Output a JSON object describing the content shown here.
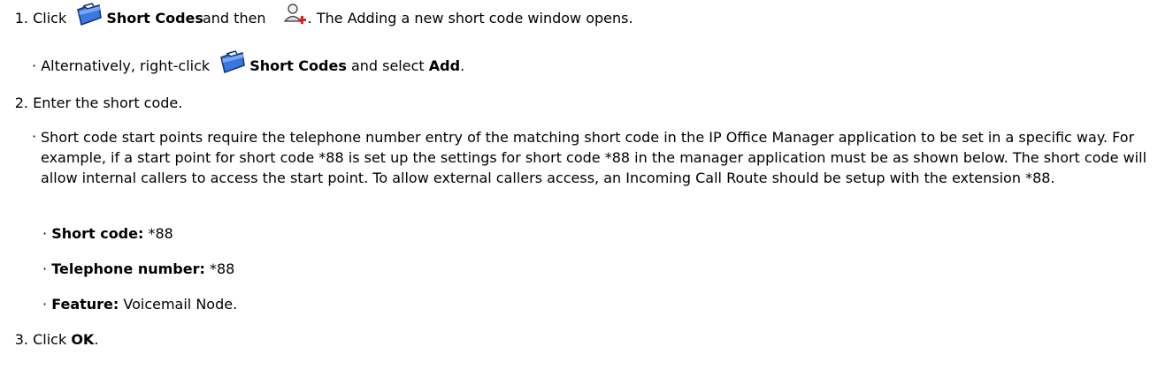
{
  "step1": {
    "number": "1.",
    "click": "Click",
    "item": "Short Codes",
    "and_then": "and then",
    "rest": ". The Adding a new short code window opens.",
    "alt_bullet": "·",
    "alt_prefix": "Alternatively, right-click",
    "alt_item": "Short Codes",
    "alt_select": "and select",
    "alt_add": "Add",
    "alt_end": "."
  },
  "step2": {
    "number": "2.",
    "text": "Enter the short code.",
    "bullet": "·",
    "paragraph": "Short code start points require the telephone number entry of the matching short code in the IP Office Manager application to be set in a specific way. For example, if a start point for short code *88 is set up the settings for short code *88 in the manager application must be as shown below. The short code will allow internal callers to access the start point. To allow external callers access, an Incoming Call Route should be setup with the extension *88.",
    "settings": [
      {
        "label": "Short code:",
        "value": " *88"
      },
      {
        "label": "Telephone number:",
        "value": " *88"
      },
      {
        "label": "Feature:",
        "value": " Voicemail Node."
      }
    ]
  },
  "step3": {
    "number": "3.",
    "click": "Click",
    "ok": "OK",
    "end": "."
  },
  "icons": {
    "folder": "short-codes-folder-icon",
    "add": "add-person-icon",
    "folder_color": "#1a56c9",
    "add_accent": "#e0201b"
  }
}
